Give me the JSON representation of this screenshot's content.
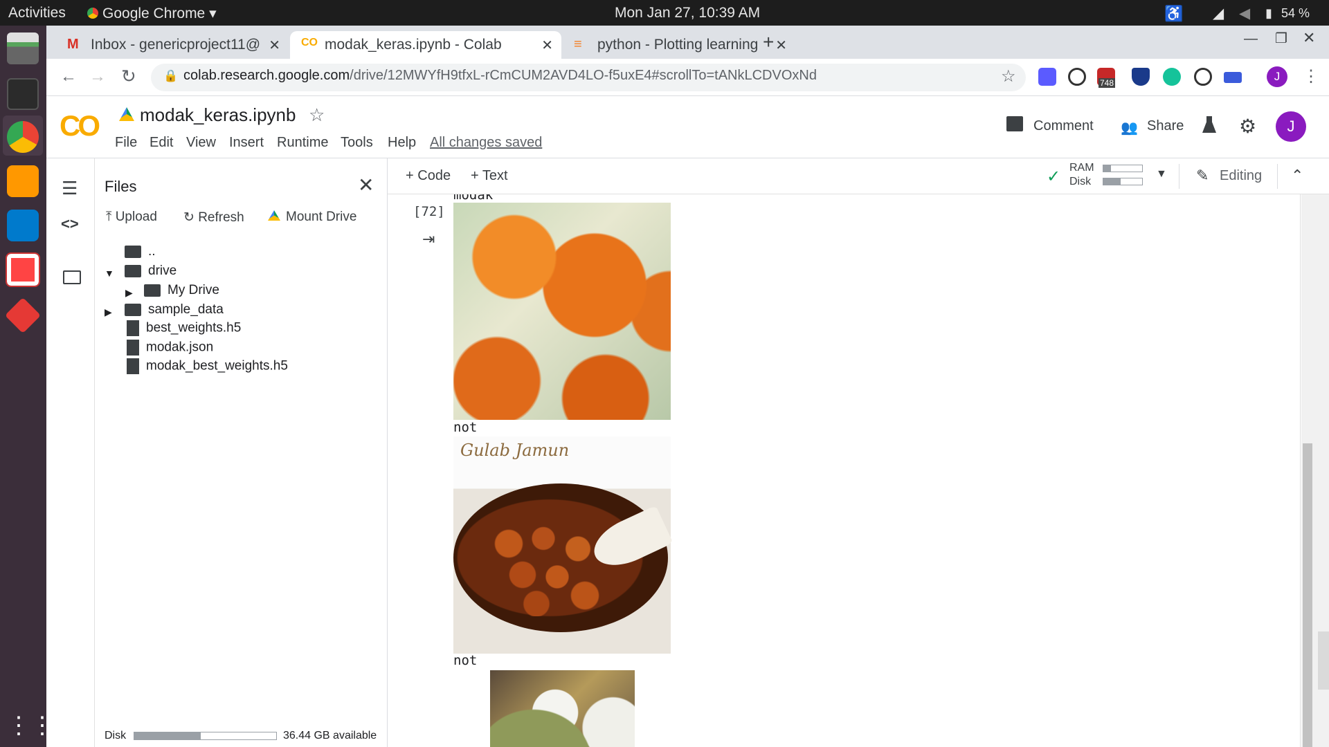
{
  "os": {
    "activities": "Activities",
    "app_menu": "Google Chrome",
    "clock": "Mon Jan 27, 10:39 AM",
    "battery": "54 %"
  },
  "tabs": [
    {
      "label": "Inbox - genericproject11@",
      "icon": "gmail-icon"
    },
    {
      "label": "modak_keras.ipynb - Colab",
      "icon": "colab-icon"
    },
    {
      "label": "python - Plotting learning",
      "icon": "stackoverflow-icon"
    }
  ],
  "browser": {
    "url_host": "colab.research.google.com",
    "url_path": "/drive/12MWYfH9tfxL-rCmCUM2AVD4LO-f5uxE4#scrollTo=tANkLCDVOxNd",
    "ext_badge": "748",
    "profile_initial": "J"
  },
  "colab": {
    "logo": "CO",
    "notebook_title": "modak_keras.ipynb",
    "menu": [
      "File",
      "Edit",
      "View",
      "Insert",
      "Runtime",
      "Tools",
      "Help"
    ],
    "saved_status": "All changes saved",
    "comment": "Comment",
    "share": "Share",
    "avatar_initial": "J"
  },
  "files_panel": {
    "title": "Files",
    "upload": "Upload",
    "refresh": "Refresh",
    "mount": "Mount Drive",
    "tree": [
      {
        "label": "..",
        "type": "up"
      },
      {
        "label": "drive",
        "type": "folder"
      },
      {
        "label": "My Drive",
        "type": "folder"
      },
      {
        "label": "sample_data",
        "type": "folder"
      },
      {
        "label": "best_weights.h5",
        "type": "file"
      },
      {
        "label": "modak.json",
        "type": "file"
      },
      {
        "label": "modak_best_weights.h5",
        "type": "file"
      }
    ],
    "disk_label": "Disk",
    "disk_available": "36.44 GB available",
    "disk_used_fraction": 0.47
  },
  "toolbar": {
    "add_code": "Code",
    "add_text": "Text",
    "ram": "RAM",
    "disk": "Disk",
    "ram_fraction": 0.2,
    "disk_fraction": 0.45,
    "editing": "Editing"
  },
  "cell": {
    "exec_count": "[72]",
    "outputs": [
      "modak",
      "not",
      "not"
    ],
    "image_caption": "Gulab Jamun"
  }
}
